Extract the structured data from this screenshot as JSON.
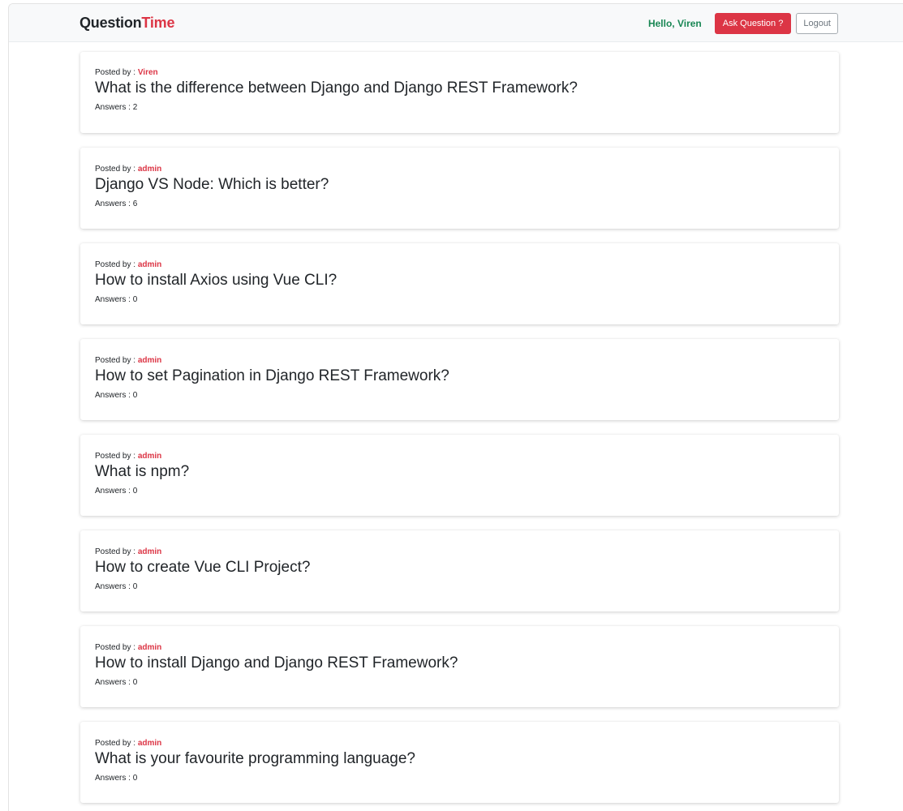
{
  "navbar": {
    "brand_main": "Question",
    "brand_accent": "Time",
    "greeting": "Hello, Viren",
    "ask_label": "Ask Question ?",
    "logout_label": "Logout"
  },
  "labels": {
    "posted_by": "Posted by : ",
    "answers": "Answers : "
  },
  "questions": [
    {
      "author": "Viren",
      "title": "What is the difference between Django and Django REST Framework?",
      "answers": "2"
    },
    {
      "author": "admin",
      "title": "Django VS Node: Which is better?",
      "answers": "6"
    },
    {
      "author": "admin",
      "title": "How to install Axios using Vue CLI?",
      "answers": "0"
    },
    {
      "author": "admin",
      "title": "How to set Pagination in Django REST Framework?",
      "answers": "0"
    },
    {
      "author": "admin",
      "title": "What is npm?",
      "answers": "0"
    },
    {
      "author": "admin",
      "title": "How to create Vue CLI Project?",
      "answers": "0"
    },
    {
      "author": "admin",
      "title": "How to install Django and Django REST Framework?",
      "answers": "0"
    },
    {
      "author": "admin",
      "title": "What is your favourite programming language?",
      "answers": "0"
    }
  ],
  "colors": {
    "accent": "#dc3545",
    "greeting": "#198754",
    "navbar_bg": "#f8f9fa"
  }
}
